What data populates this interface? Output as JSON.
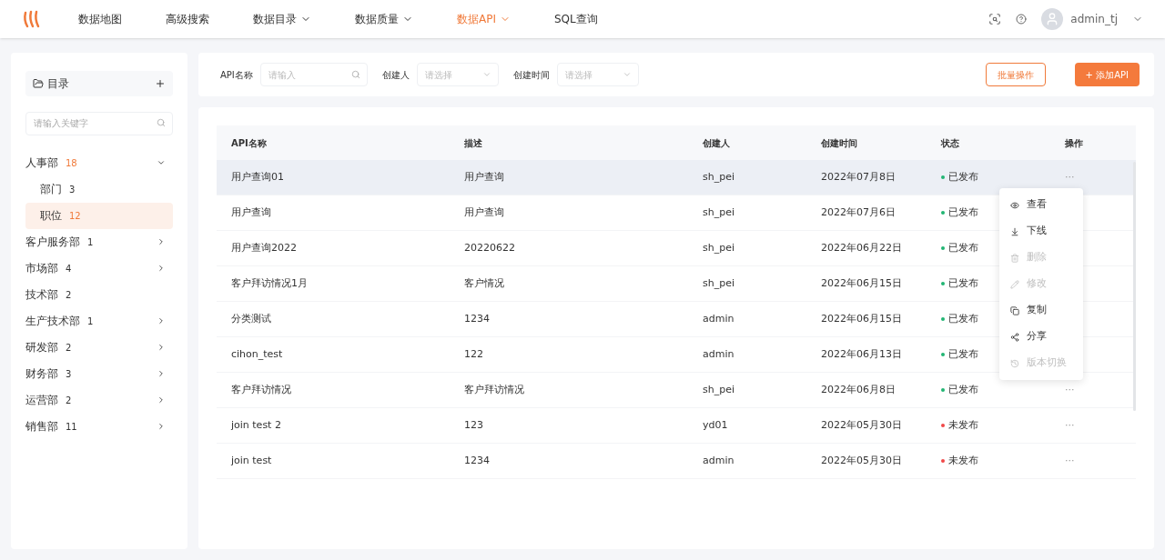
{
  "nav": {
    "items": [
      {
        "label": "数据地图",
        "selected": false,
        "dropdown": false
      },
      {
        "label": "高级搜索",
        "selected": false,
        "dropdown": false
      },
      {
        "label": "数据目录",
        "selected": false,
        "dropdown": true
      },
      {
        "label": "数据质量",
        "selected": false,
        "dropdown": true
      },
      {
        "label": "数据API",
        "selected": true,
        "dropdown": true
      },
      {
        "label": "SQL查询",
        "selected": false,
        "dropdown": false
      }
    ],
    "user": "admin_tj"
  },
  "sidebar": {
    "title": "目录",
    "search_placeholder": "请输入关键字",
    "tree": [
      {
        "label": "人事部",
        "count": "18",
        "expanded": true,
        "selected": false,
        "has_children": true,
        "children": [
          {
            "label": "部门",
            "count": "3",
            "selected": false
          },
          {
            "label": "职位",
            "count": "12",
            "selected": true
          }
        ]
      },
      {
        "label": "客户服务部",
        "count": "1",
        "expanded": false,
        "selected": false,
        "has_children": true
      },
      {
        "label": "市场部",
        "count": "4",
        "expanded": false,
        "selected": false,
        "has_children": true
      },
      {
        "label": "技术部",
        "count": "2",
        "selected": false,
        "has_children": false
      },
      {
        "label": "生产技术部",
        "count": "1",
        "expanded": false,
        "selected": false,
        "has_children": true
      },
      {
        "label": "研发部",
        "count": "2",
        "expanded": false,
        "selected": false,
        "has_children": true
      },
      {
        "label": "财务部",
        "count": "3",
        "expanded": false,
        "selected": false,
        "has_children": true
      },
      {
        "label": "运营部",
        "count": "2",
        "expanded": false,
        "selected": false,
        "has_children": true
      },
      {
        "label": "销售部",
        "count": "11",
        "expanded": false,
        "selected": false,
        "has_children": true
      }
    ]
  },
  "filters": [
    {
      "label": "API名称",
      "placeholder": "请输入",
      "kind": "search"
    },
    {
      "label": "创建人",
      "placeholder": "请选择",
      "kind": "select"
    },
    {
      "label": "创建时间",
      "placeholder": "请选择",
      "kind": "select"
    }
  ],
  "actions": {
    "batch": "批量操作",
    "add": "+ 添加API"
  },
  "table": {
    "columns": [
      "API名称",
      "描述",
      "创建人",
      "创建时间",
      "状态",
      "操作"
    ],
    "rows": [
      {
        "name": "用户查询01",
        "desc": "用户查询",
        "creator": "sh_pei",
        "time": "2022年07月8日",
        "status": "已发布",
        "kind": "published",
        "ops": "···",
        "selected": true
      },
      {
        "name": "用户查询",
        "desc": "用户查询",
        "creator": "sh_pei",
        "time": "2022年07月6日",
        "status": "已发布",
        "kind": "published",
        "selected": false
      },
      {
        "name": "用户查询2022",
        "desc": "20220622",
        "creator": "sh_pei",
        "time": "2022年06月22日",
        "status": "已发布",
        "kind": "published",
        "selected": false
      },
      {
        "name": "客户拜访情况1月",
        "desc": "客户情况",
        "creator": "sh_pei",
        "time": "2022年06月15日",
        "status": "已发布",
        "kind": "published",
        "selected": false
      },
      {
        "name": "分类测试",
        "desc": "1234",
        "creator": "admin",
        "time": "2022年06月15日",
        "status": "已发布",
        "kind": "published",
        "selected": false
      },
      {
        "name": "cihon_test",
        "desc": "122",
        "creator": "admin",
        "time": "2022年06月13日",
        "status": "已发布",
        "kind": "published",
        "selected": false
      },
      {
        "name": "客户拜访情况",
        "desc": "客户拜访情况",
        "creator": "sh_pei",
        "time": "2022年06月8日",
        "status": "已发布",
        "kind": "published",
        "ops": "···",
        "selected": false
      },
      {
        "name": "join test 2",
        "desc": "123",
        "creator": "yd01",
        "time": "2022年05月30日",
        "status": "未发布",
        "kind": "unpublished",
        "ops": "···",
        "selected": false
      },
      {
        "name": "join test",
        "desc": "1234",
        "creator": "admin",
        "time": "2022年05月30日",
        "status": "未发布",
        "kind": "unpublished",
        "ops": "···",
        "selected": false
      }
    ]
  },
  "menu": [
    {
      "label": "查看",
      "disabled": false
    },
    {
      "label": "下线",
      "disabled": false
    },
    {
      "label": "删除",
      "disabled": true
    },
    {
      "label": "修改",
      "disabled": true
    },
    {
      "label": "复制",
      "disabled": false
    },
    {
      "label": "分享",
      "disabled": false
    },
    {
      "label": "版本切换",
      "disabled": true
    }
  ]
}
